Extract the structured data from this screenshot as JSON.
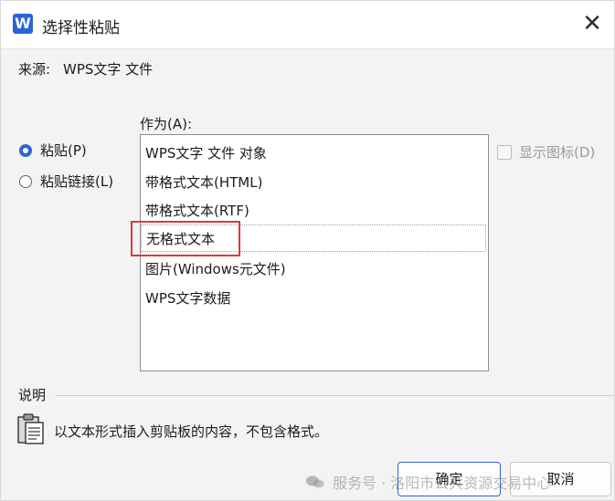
{
  "window": {
    "app_icon": "W",
    "title": "选择性粘贴",
    "close": "✕"
  },
  "source": {
    "label": "来源:",
    "value": "WPS文字 文件"
  },
  "as_label": "作为(A):",
  "modes": [
    {
      "label": "粘贴(P)",
      "selected": true
    },
    {
      "label": "粘贴链接(L)",
      "selected": false
    }
  ],
  "formats": [
    "WPS文字 文件 对象",
    "带格式文本(HTML)",
    "带格式文本(RTF)",
    "无格式文本",
    "图片(Windows元文件)",
    "WPS文字数据"
  ],
  "selected_format": "无格式文本",
  "show_icon": {
    "label": "显示图标(D)",
    "checked": false,
    "enabled": false
  },
  "description": {
    "label": "说明",
    "text": "以文本形式插入剪贴板的内容，不包含格式。",
    "icon": "clipboard-icon"
  },
  "buttons": {
    "ok": "确定",
    "cancel": "取消"
  },
  "watermark": "服务号 · 洛阳市公共资源交易中心",
  "colors": {
    "accent": "#2b63d9",
    "highlight": "#d93a3a"
  }
}
